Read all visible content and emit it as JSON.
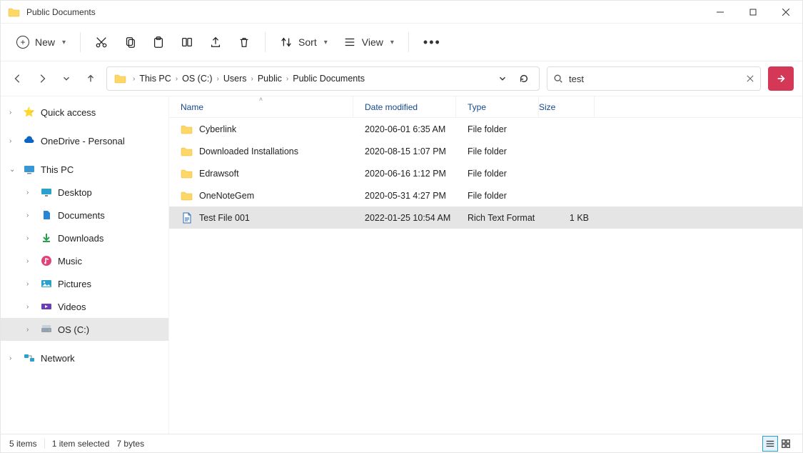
{
  "window": {
    "title": "Public Documents"
  },
  "toolbar": {
    "new_label": "New",
    "sort_label": "Sort",
    "view_label": "View"
  },
  "breadcrumbs": [
    "This PC",
    "OS (C:)",
    "Users",
    "Public",
    "Public Documents"
  ],
  "search": {
    "value": "test"
  },
  "sidebar": {
    "quick_access": "Quick access",
    "onedrive": "OneDrive - Personal",
    "this_pc": "This PC",
    "pc_children": [
      "Desktop",
      "Documents",
      "Downloads",
      "Music",
      "Pictures",
      "Videos",
      "OS (C:)"
    ],
    "network": "Network"
  },
  "columns": {
    "name": "Name",
    "date": "Date modified",
    "type": "Type",
    "size": "Size"
  },
  "rows": [
    {
      "name": "Cyberlink",
      "date": "2020-06-01 6:35 AM",
      "type": "File folder",
      "size": "",
      "icon": "folder",
      "sel": false
    },
    {
      "name": "Downloaded Installations",
      "date": "2020-08-15 1:07 PM",
      "type": "File folder",
      "size": "",
      "icon": "folder",
      "sel": false
    },
    {
      "name": "Edrawsoft",
      "date": "2020-06-16 1:12 PM",
      "type": "File folder",
      "size": "",
      "icon": "folder",
      "sel": false
    },
    {
      "name": "OneNoteGem",
      "date": "2020-05-31 4:27 PM",
      "type": "File folder",
      "size": "",
      "icon": "folder",
      "sel": false
    },
    {
      "name": "Test File 001",
      "date": "2022-01-25 10:54 AM",
      "type": "Rich Text Format",
      "size": "1 KB",
      "icon": "rtf",
      "sel": true
    }
  ],
  "status": {
    "count": "5 items",
    "selected": "1 item selected",
    "bytes": "7 bytes"
  }
}
